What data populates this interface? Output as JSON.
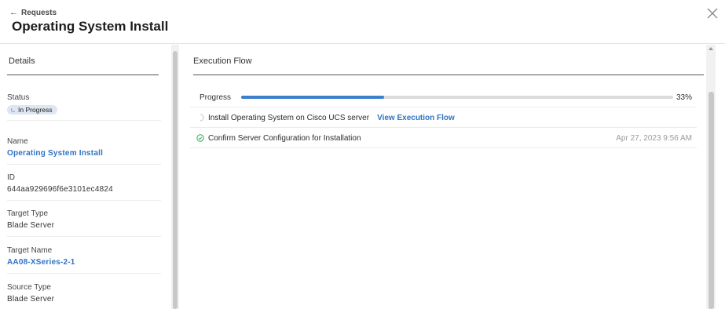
{
  "header": {
    "back_label": "Requests",
    "title": "Operating System Install"
  },
  "details": {
    "heading": "Details",
    "fields": [
      {
        "label": "Status",
        "value": "In Progress",
        "type": "badge"
      },
      {
        "label": "Name",
        "value": "Operating System Install",
        "type": "link"
      },
      {
        "label": "ID",
        "value": "644aa929696f6e3101ec4824",
        "type": "text"
      },
      {
        "label": "Target Type",
        "value": "Blade Server",
        "type": "text"
      },
      {
        "label": "Target Name",
        "value": "AA08-XSeries-2-1",
        "type": "link"
      },
      {
        "label": "Source Type",
        "value": "Blade Server",
        "type": "text"
      }
    ]
  },
  "execution_flow": {
    "heading": "Execution Flow",
    "progress": {
      "label": "Progress",
      "value": 0.33,
      "percent_text": "33%"
    },
    "steps": [
      {
        "status": "in-progress",
        "text": "Install Operating System on Cisco UCS server",
        "link": "View Execution Flow",
        "time": ""
      },
      {
        "status": "completed",
        "text": "Confirm Server Configuration for Installation",
        "link": "",
        "time": "Apr 27, 2023 9:56 AM"
      }
    ]
  },
  "colors": {
    "accent": "#3d7fcd",
    "link": "#2f72c4",
    "success": "#3aa655",
    "badge_bg": "#dde6f1"
  }
}
